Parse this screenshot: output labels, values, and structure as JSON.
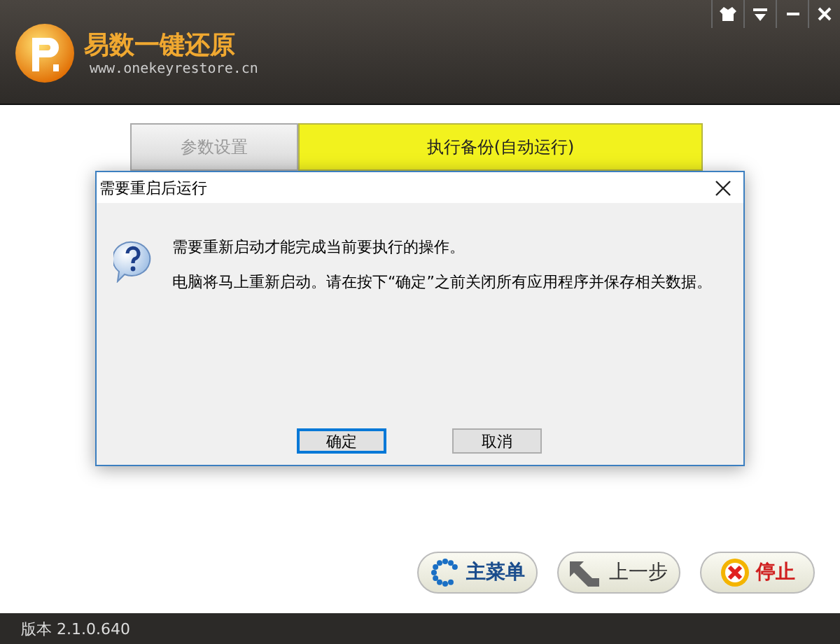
{
  "header": {
    "title": "易数一键还原",
    "url": "www.onekeyrestore.cn"
  },
  "steps": [
    {
      "label": "参数设置",
      "selected": false
    },
    {
      "label": "执行备份(自动运行)",
      "selected": true
    }
  ],
  "dialog": {
    "title": "需要重启后运行",
    "messages": [
      "需要重新启动才能完成当前要执行的操作。",
      "电脑将马上重新启动。请在按下“确定”之前关闭所有应用程序并保存相关数据。"
    ],
    "buttons": [
      {
        "label": "确定",
        "selected": true
      },
      {
        "label": "取消",
        "selected": false
      }
    ]
  },
  "actions": [
    {
      "label": "主菜单",
      "kind": "menu"
    },
    {
      "label": "上一步",
      "kind": "back"
    },
    {
      "label": "停止",
      "kind": "stop"
    }
  ],
  "status_bar": {
    "version": "版本 2.1.0.640"
  }
}
